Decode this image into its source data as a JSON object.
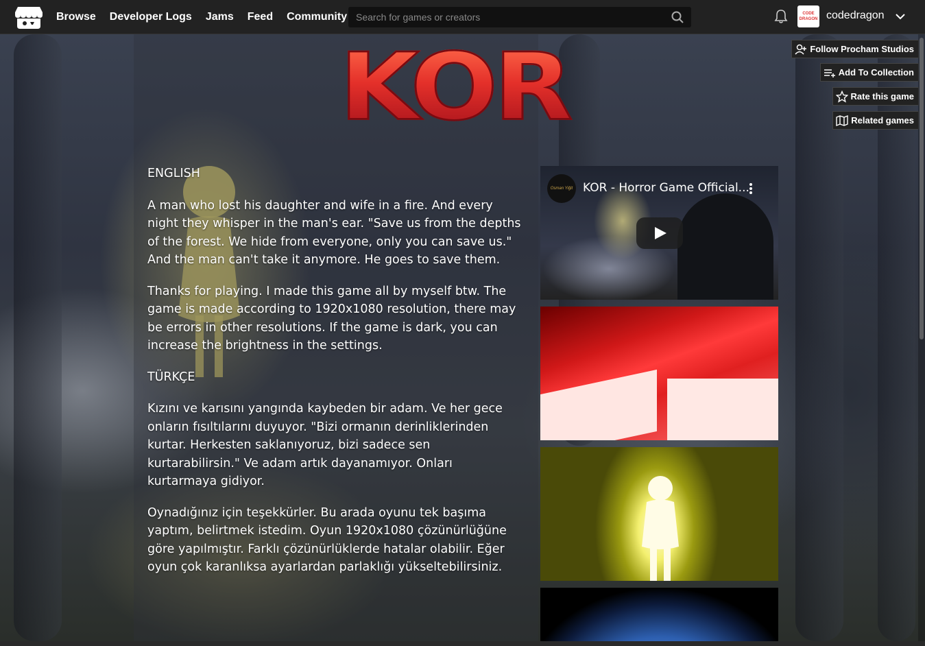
{
  "nav": {
    "items": [
      {
        "label": "Browse"
      },
      {
        "label": "Developer Logs"
      },
      {
        "label": "Jams"
      },
      {
        "label": "Feed"
      },
      {
        "label": "Community"
      }
    ],
    "search_placeholder": "Search for games or creators",
    "username": "codedragon",
    "avatar_text": "CODE DRAGON"
  },
  "game": {
    "title": "KOR",
    "description": [
      {
        "type": "heading",
        "text": "ENGLISH"
      },
      {
        "type": "para",
        "text": "A man who lost his daughter and wife in a fire. And every night they whisper in the man's ear. \"Save us from the depths of the forest.  We hide from everyone, only you can save us.\" And the man can't take it anymore. He goes to save them."
      },
      {
        "type": "para",
        "text": "Thanks for playing. I made this game all by myself btw. The game is made according to 1920x1080 resolution, there may be errors in other resolutions. If the game is dark, you can increase the brightness in the settings."
      },
      {
        "type": "heading",
        "text": "TÜRKÇE"
      },
      {
        "type": "para",
        "text": "Kızını ve karısını yangında kaybeden bir adam. Ve her gece onların fısıltılarını duyuyor. \"Bizi ormanın derinliklerinden kurtar. Herkesten saklanıyoruz, bizi sadece sen kurtarabilirsin.\" Ve adam artık dayanamıyor. Onları kurtarmaya gidiyor."
      },
      {
        "type": "para",
        "text": " Oynadığınız için teşekkürler. Bu arada oyunu tek başıma yaptım, belirtmek istedim. Oyun 1920x1080 çözünürlüğüne göre yapılmıştır. Farklı çözünürlüklerde hatalar olabilir. Eğer oyun çok karanlıksa ayarlardan parlaklığı yükseltebilirsiniz."
      }
    ]
  },
  "video": {
    "title": "KOR - Horror Game Official...",
    "channel_text": "Osman Yiğit"
  },
  "actions": {
    "follow": "Follow Procham Studios",
    "collection": "Add To Collection",
    "rate": "Rate this game",
    "related": "Related games"
  },
  "colors": {
    "topbar": "#222222",
    "title_red": "#e4302a",
    "button_bg": "#222222"
  }
}
